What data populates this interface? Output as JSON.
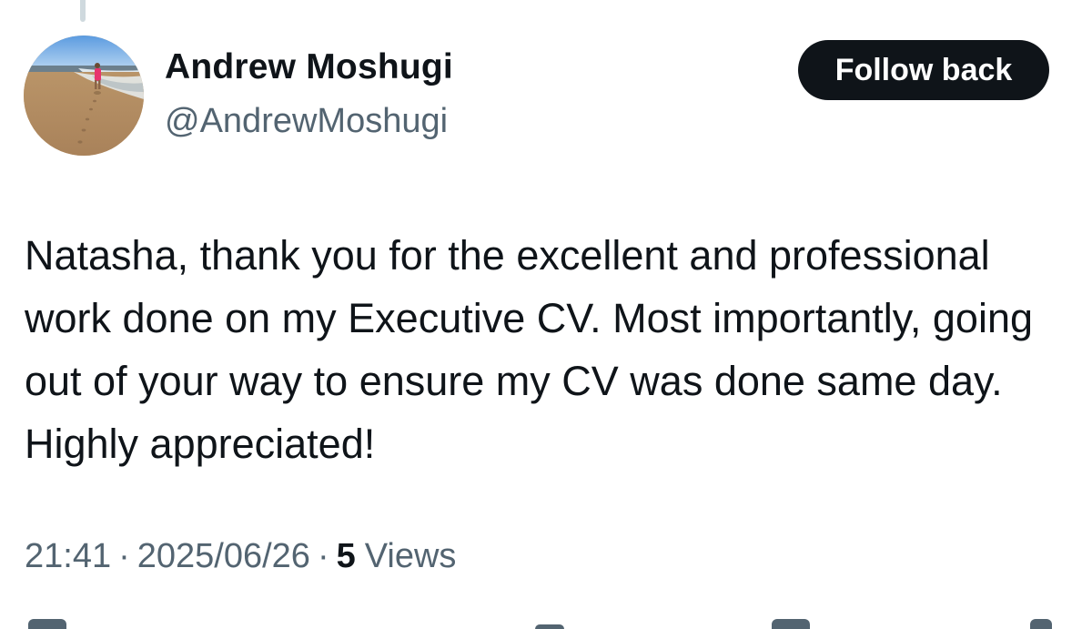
{
  "author": {
    "display_name": "Andrew Moshugi",
    "handle": "@AndrewMoshugi"
  },
  "follow_button": {
    "label": "Follow back"
  },
  "tweet": {
    "text": "Natasha, thank you for the excellent and professional work done on my Executive CV. Most importantly, going out of your way to ensure my CV was done same day. Highly appreciated!"
  },
  "meta": {
    "time": "21:41",
    "date": "2025/06/26",
    "separator": "·",
    "views_count": "5",
    "views_label": "Views"
  },
  "icons": {
    "avatar": "beach-photo",
    "actions": [
      "reply-icon",
      "repost-icon",
      "like-icon",
      "bookmark-icon",
      "share-icon"
    ]
  },
  "colors": {
    "text": "#0f1419",
    "muted": "#536471",
    "button_bg": "#0f1419",
    "button_text": "#ffffff"
  }
}
